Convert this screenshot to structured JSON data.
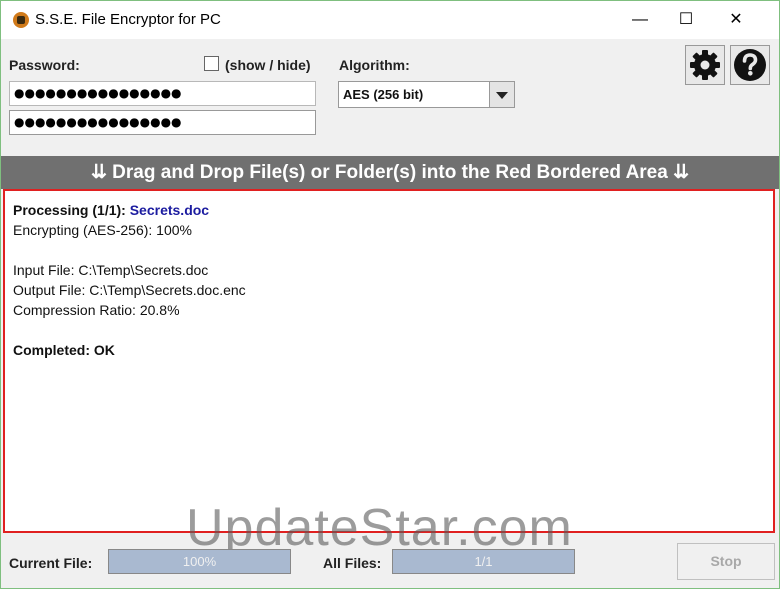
{
  "window": {
    "title": "S.S.E. File Encryptor for PC",
    "minimize_glyph": "—",
    "maximize_glyph": "☐",
    "close_glyph": "✕"
  },
  "password": {
    "label": "Password:",
    "show_hide_label": "(show / hide)",
    "show_checked": false,
    "value": "●●●●●●●●●●●●●●●●",
    "confirm_value": "●●●●●●●●●●●●●●●●"
  },
  "algorithm": {
    "label": "Algorithm:",
    "selected": "AES (256 bit)"
  },
  "toolbar": {
    "settings_icon": "gear-icon",
    "help_icon": "question-icon"
  },
  "drop_bar": {
    "text": "⇊ Drag and Drop File(s) or Folder(s) into the Red Bordered Area ⇊"
  },
  "log": {
    "processing_label": "Processing (1/1):",
    "processing_file": "Secrets.doc",
    "encrypting": "Encrypting (AES-256): 100%",
    "input_file": "Input File: C:\\Temp\\Secrets.doc",
    "output_file": "Output File: C:\\Temp\\Secrets.doc.enc",
    "compression": "Compression Ratio: 20.8%",
    "completed": "Completed: OK"
  },
  "status": {
    "current_file_label": "Current File:",
    "current_progress_text": "100%",
    "current_progress": 1.0,
    "all_files_label": "All Files:",
    "all_progress_text": "1/1",
    "all_progress": 1.0,
    "stop_label": "Stop"
  },
  "watermark": "UpdateStar.com",
  "colors": {
    "drop_border": "#e02020",
    "drop_bar": "#707070",
    "file_name": "#1c1ca0",
    "progress_fill": "#a9b9d0"
  }
}
